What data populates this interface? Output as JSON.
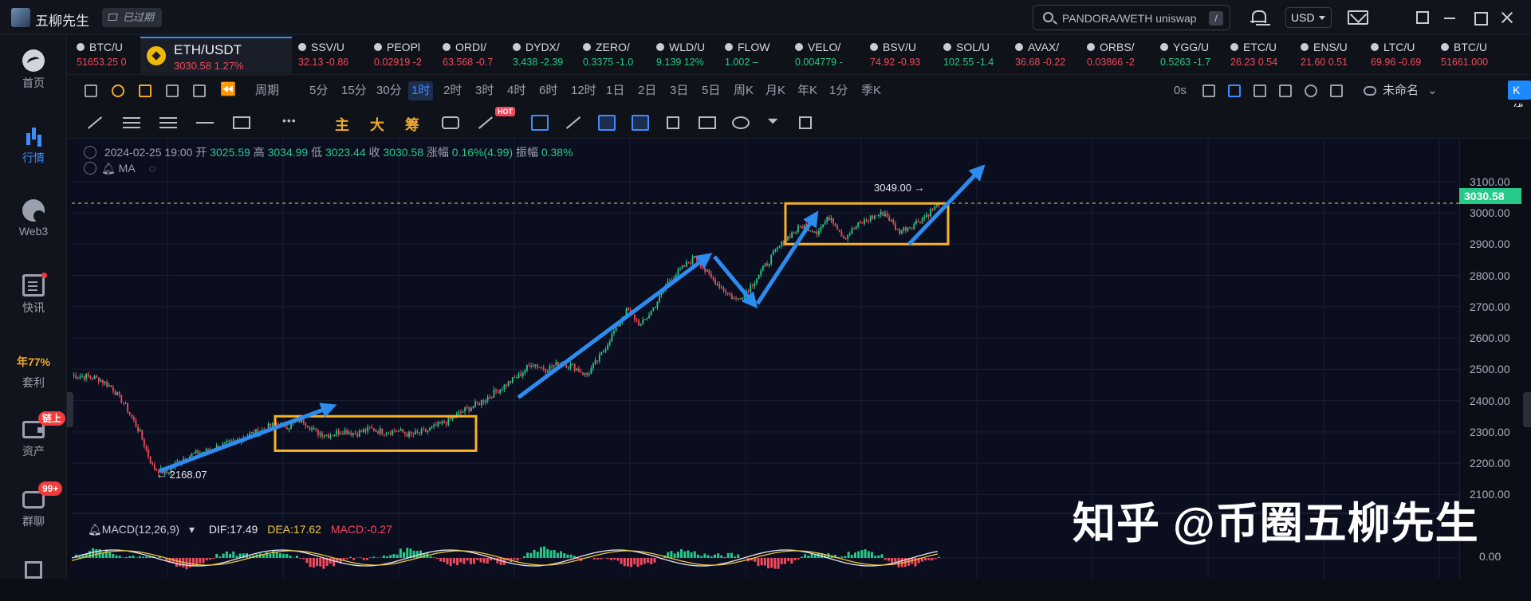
{
  "app": {
    "title": "五柳先生",
    "expired_label": "已过期"
  },
  "search": {
    "value": "PANDORA/WETH uniswap",
    "shortcut": "/"
  },
  "currency": "USD",
  "sidebar": {
    "items": [
      {
        "label": "首页",
        "icon": "home-icon"
      },
      {
        "label": "行情",
        "icon": "market-chart-icon",
        "active": true
      },
      {
        "label": "Web3",
        "icon": "web3-icon"
      },
      {
        "label": "快讯",
        "icon": "news-icon"
      },
      {
        "label": "套利",
        "rate": "年77%"
      },
      {
        "label": "资产",
        "icon": "wallet-icon",
        "badge": "链上"
      },
      {
        "label": "群聊",
        "icon": "chat-icon",
        "badge": "99+"
      }
    ]
  },
  "tickers": [
    {
      "sym": "BTC/U",
      "price": "51653.25",
      "chg": "0",
      "dir": "dn"
    },
    {
      "sym": "ETH/USDT",
      "price": "3030.58",
      "chg": "1.27%",
      "dir": "dn",
      "active": true
    },
    {
      "sym": "SSV/U",
      "price": "32.13",
      "chg": "-0.86",
      "dir": "dn"
    },
    {
      "sym": "PEOPl",
      "price": "0.02919",
      "chg": "-2",
      "dir": "dn"
    },
    {
      "sym": "ORDI/",
      "price": "63.568",
      "chg": "-0.7",
      "dir": "dn"
    },
    {
      "sym": "DYDX/",
      "price": "3.438",
      "chg": "-2.39",
      "dir": "up"
    },
    {
      "sym": "ZERO/",
      "price": "0.3375",
      "chg": "-1.0",
      "dir": "up"
    },
    {
      "sym": "WLD/U",
      "price": "9.139",
      "chg": "12%",
      "dir": "up"
    },
    {
      "sym": "FLOW",
      "price": "1.002",
      "chg": "–",
      "dir": "up"
    },
    {
      "sym": "VELO/",
      "price": "0.004779",
      "chg": "-",
      "dir": "up"
    },
    {
      "sym": "BSV/U",
      "price": "74.92",
      "chg": "-0.93",
      "dir": "dn"
    },
    {
      "sym": "SOL/U",
      "price": "102.55",
      "chg": "-1.4",
      "dir": "up"
    },
    {
      "sym": "AVAX/",
      "price": "36.68",
      "chg": "-0.22",
      "dir": "dn"
    },
    {
      "sym": "ORBS/",
      "price": "0.03866",
      "chg": "-2",
      "dir": "dn"
    },
    {
      "sym": "YGG/U",
      "price": "0.5263",
      "chg": "-1.7",
      "dir": "up"
    },
    {
      "sym": "ETC/U",
      "price": "26.23",
      "chg": "0.54",
      "dir": "dn"
    },
    {
      "sym": "ENS/U",
      "price": "21.60",
      "chg": "0.51",
      "dir": "dn"
    },
    {
      "sym": "LTC/U",
      "price": "69.96",
      "chg": "-0.69",
      "dir": "dn"
    },
    {
      "sym": "BTC/U",
      "price": "51661.000",
      "chg": "",
      "dir": "dn"
    }
  ],
  "periods": {
    "dropdown": "周期",
    "items": [
      "5分",
      "15分",
      "30分",
      "1时",
      "2时",
      "3时",
      "4时",
      "6时",
      "12时",
      "1日",
      "2日",
      "3日",
      "5日",
      "周K",
      "月K",
      "年K",
      "1分",
      "季K"
    ],
    "active": "1时"
  },
  "toolbar_right": {
    "countdown": "0s",
    "layout_name": "未命名",
    "analysis_button": "K线分析"
  },
  "drawing_tools": {
    "main_label": "主",
    "big_label": "大",
    "chip_label": "筹",
    "hot_badge": "HOT"
  },
  "ohlc": {
    "datetime": "2024-02-25 19:00",
    "open_label": "开",
    "open": "3025.59",
    "high_label": "高",
    "high": "3034.99",
    "low_label": "低",
    "low": "3023.44",
    "close_label": "收",
    "close": "3030.58",
    "change_label": "涨幅",
    "change": "0.16%(4.99)",
    "amp_label": "振幅",
    "amp": "0.38%",
    "ma_label": "MA"
  },
  "macd": {
    "name": "MACD(12,26,9)",
    "dif": "DIF:17.49",
    "dea": "DEA:17.62",
    "macd": "MACD:-0.27",
    "zero": "0.00"
  },
  "price_axis": [
    "3100.00",
    "3000.00",
    "2900.00",
    "2800.00",
    "2700.00",
    "2600.00",
    "2500.00",
    "2400.00",
    "2300.00",
    "2200.00",
    "2100.00"
  ],
  "current_price": "3030.58",
  "annotations": {
    "low": "← 2168.07",
    "high": "3049.00 →"
  },
  "watermark": "知乎 @币圈五柳先生",
  "chart_data": {
    "type": "line",
    "title": "",
    "ylim": [
      2040,
      3140
    ],
    "y_ticks": [
      3100,
      3000,
      2900,
      2800,
      2700,
      2600,
      2500,
      2400,
      2300,
      2200,
      2100
    ],
    "series": [
      {
        "values": [
          2480,
          2478,
          2470,
          2440,
          2380,
          2300,
          2185,
          2168,
          2210,
          2230,
          2240,
          2255,
          2268,
          2290,
          2305,
          2325,
          2318,
          2340,
          2300,
          2290,
          2305,
          2295,
          2310,
          2300,
          2305,
          2290,
          2300,
          2320,
          2340,
          2370,
          2390,
          2420,
          2450,
          2480,
          2520,
          2500,
          2520,
          2510,
          2480,
          2540,
          2620,
          2690,
          2640,
          2700,
          2780,
          2820,
          2860,
          2800,
          2760,
          2720,
          2760,
          2820,
          2880,
          2930,
          2960,
          2940,
          2990,
          2920,
          2960,
          2985,
          3000,
          2940,
          2960,
          2990,
          3030
        ]
      }
    ],
    "current_price": 3030.58,
    "low_marker": 2168.07,
    "high_marker": 3049.0,
    "macd_range": [
      -60,
      60
    ]
  }
}
